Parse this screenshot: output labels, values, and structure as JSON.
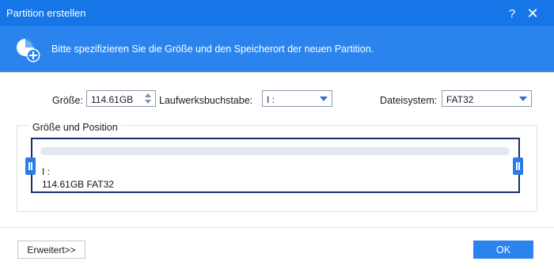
{
  "window": {
    "title": "Partition erstellen",
    "help_glyph": "?",
    "close_glyph": "✕"
  },
  "banner": {
    "text": "Bitte spezifizieren Sie die Größe und den Speicherort der neuen Partition.",
    "icon": "partition-add-icon"
  },
  "form": {
    "size_label": "Größe:",
    "size_value": "114.61GB",
    "drive_letter_label": "Laufwerksbuchstabe:",
    "drive_letter_value": "I :",
    "filesystem_label": "Dateisystem:",
    "filesystem_value": "FAT32"
  },
  "group": {
    "title": "Größe und Position",
    "partition_letter": "I :",
    "partition_info": "114.61GB FAT32"
  },
  "footer": {
    "advanced_prefix": "E",
    "advanced_rest": "rweitert>>",
    "ok_label": "OK"
  },
  "colors": {
    "titlebar": "#1676e7",
    "banner": "#2b84ee",
    "partition_border": "#1b2f6a",
    "handle": "#2b7be5",
    "ok_button": "#2b84ee"
  }
}
